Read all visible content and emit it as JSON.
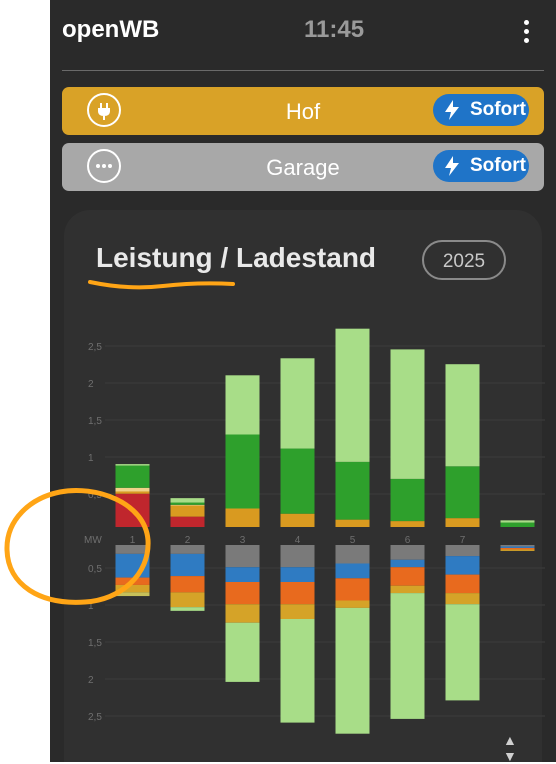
{
  "header": {
    "app_name": "openWB",
    "time": "11:45",
    "menu_icon": "kebab-menu-icon"
  },
  "chargepoints": [
    {
      "name": "Hof",
      "color": "#d9a227",
      "icon": "plug-icon",
      "mode": "Sofort"
    },
    {
      "name": "Garage",
      "color": "#a8a8a8",
      "icon": "more-dots-icon",
      "mode": "Sofort"
    }
  ],
  "chart_card": {
    "title": "Leistung / Ladestand",
    "year": "2025"
  },
  "chart_data": {
    "type": "bar",
    "unit_label": "MW",
    "categories": [
      "1",
      "2",
      "3",
      "4",
      "5",
      "6",
      "7",
      ""
    ],
    "y_ticks": [
      "2,5",
      "2",
      "1,5",
      "1",
      "0,5"
    ],
    "ylim": [
      0,
      2.7
    ],
    "positive_series_colors": [
      "#c0262d",
      "#d99a20",
      "#f0d38a",
      "#2ea02c",
      "#a8dd88"
    ],
    "negative_series_colors": [
      "#7a7a7a",
      "#2f7bc2",
      "#e86a1e",
      "#d5a328",
      "#c6c05a",
      "#a8dd88"
    ],
    "positive_stacks": [
      [
        0.45,
        0.03,
        0.05,
        0.3,
        0.02
      ],
      [
        0.14,
        0.15,
        0.01,
        0.03,
        0.06
      ],
      [
        0.0,
        0.25,
        0.0,
        1.0,
        0.8
      ],
      [
        0.0,
        0.18,
        0.0,
        0.88,
        1.22
      ],
      [
        0.0,
        0.1,
        0.0,
        0.78,
        1.8
      ],
      [
        0.0,
        0.08,
        0.0,
        0.57,
        1.75
      ],
      [
        0.0,
        0.12,
        0.0,
        0.7,
        1.38
      ],
      [
        0.0,
        0.0,
        0.0,
        0.06,
        0.03
      ]
    ],
    "negative_stacks": [
      [
        0.12,
        0.32,
        0.1,
        0.1,
        0.05,
        0.0
      ],
      [
        0.12,
        0.3,
        0.22,
        0.2,
        0.0,
        0.05
      ],
      [
        0.3,
        0.2,
        0.3,
        0.25,
        0.0,
        0.8
      ],
      [
        0.3,
        0.2,
        0.3,
        0.2,
        0.0,
        1.4
      ],
      [
        0.25,
        0.2,
        0.3,
        0.1,
        0.0,
        1.7
      ],
      [
        0.2,
        0.1,
        0.25,
        0.1,
        0.0,
        1.7
      ],
      [
        0.15,
        0.25,
        0.25,
        0.15,
        0.0,
        1.3
      ],
      [
        0.02,
        0.02,
        0.02,
        0.02,
        0.0,
        0.0
      ]
    ]
  },
  "annotations": {
    "underline_color": "#ffa516",
    "circle_color": "#ffa516"
  },
  "footer": {
    "sort_icon": "sort-updown-icon"
  }
}
